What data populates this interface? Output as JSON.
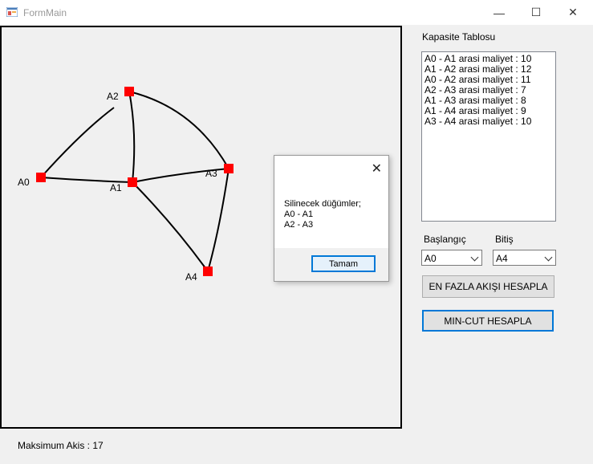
{
  "window": {
    "title": "FormMain",
    "controls": {
      "minimize": "—",
      "maximize": "☐",
      "close": "✕"
    }
  },
  "graph": {
    "nodes": [
      {
        "id": "A0",
        "label": "A0"
      },
      {
        "id": "A1",
        "label": "A1"
      },
      {
        "id": "A2",
        "label": "A2"
      },
      {
        "id": "A3",
        "label": "A3"
      },
      {
        "id": "A4",
        "label": "A4"
      }
    ],
    "edges": [
      [
        "A0",
        "A1"
      ],
      [
        "A1",
        "A2"
      ],
      [
        "A0",
        "A2"
      ],
      [
        "A2",
        "A3"
      ],
      [
        "A1",
        "A3"
      ],
      [
        "A1",
        "A4"
      ],
      [
        "A3",
        "A4"
      ]
    ],
    "node_color": "#ff0000"
  },
  "capacity_table": {
    "label": "Kapasite Tablosu",
    "items": [
      "A0 - A1 arasi maliyet : 10",
      "A1 - A2 arasi maliyet : 12",
      "A0 - A2 arasi maliyet : 11",
      "A2 - A3 arasi maliyet : 7",
      "A1 - A3 arasi maliyet : 8",
      "A1 - A4 arasi maliyet : 9",
      "A3 - A4 arasi maliyet : 10"
    ]
  },
  "start": {
    "label": "Başlangıç",
    "value": "A0"
  },
  "end": {
    "label": "Bitiş",
    "value": "A4"
  },
  "buttons": {
    "max_flow": "EN FAZLA AKIŞI HESAPLA",
    "min_cut": "MIN-CUT HESAPLA"
  },
  "status": "Maksimum Akis : 17",
  "dialog": {
    "close": "✕",
    "lines": [
      "Silinecek düğümler;",
      "A0 - A1",
      "A2 - A3"
    ],
    "ok_label": "Tamam"
  }
}
